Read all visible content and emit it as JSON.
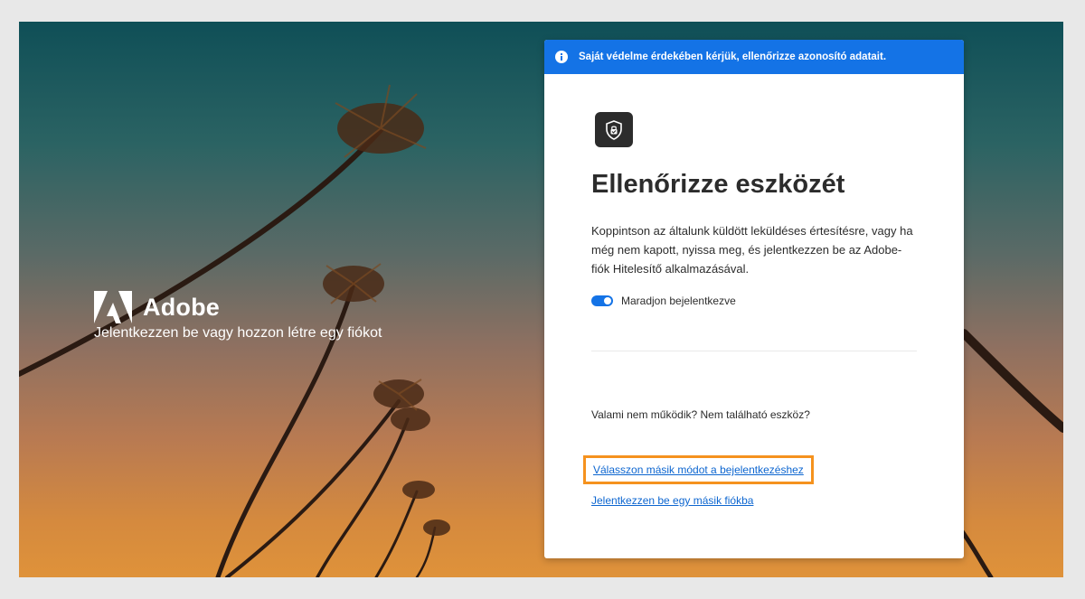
{
  "brand": {
    "name": "Adobe",
    "tagline": "Jelentkezzen be vagy hozzon létre egy fiókot"
  },
  "banner": {
    "icon": "info-icon",
    "text": "Saját védelme érdekében kérjük, ellenőrizze azonosító adatait."
  },
  "card": {
    "icon": "shield-lock-icon",
    "title": "Ellenőrizze eszközét",
    "description": "Koppintson az általunk küldött leküldéses értesítésre, vagy ha még nem kapott, nyissa meg, és jelentkezzen be az Adobe-fiók Hitelesítő alkalmazásával.",
    "stay_signed_in": {
      "label": "Maradjon bejelentkezve",
      "checked": true
    },
    "help_text": "Valami nem működik? Nem található eszköz?",
    "alt_method_link": "Válasszon másik módot a bejelentkezéshez",
    "other_account_link": "Jelentkezzen be egy másik fiókba"
  },
  "colors": {
    "accent": "#1473e6",
    "highlight": "#f5921e",
    "text": "#2c2c2c"
  }
}
